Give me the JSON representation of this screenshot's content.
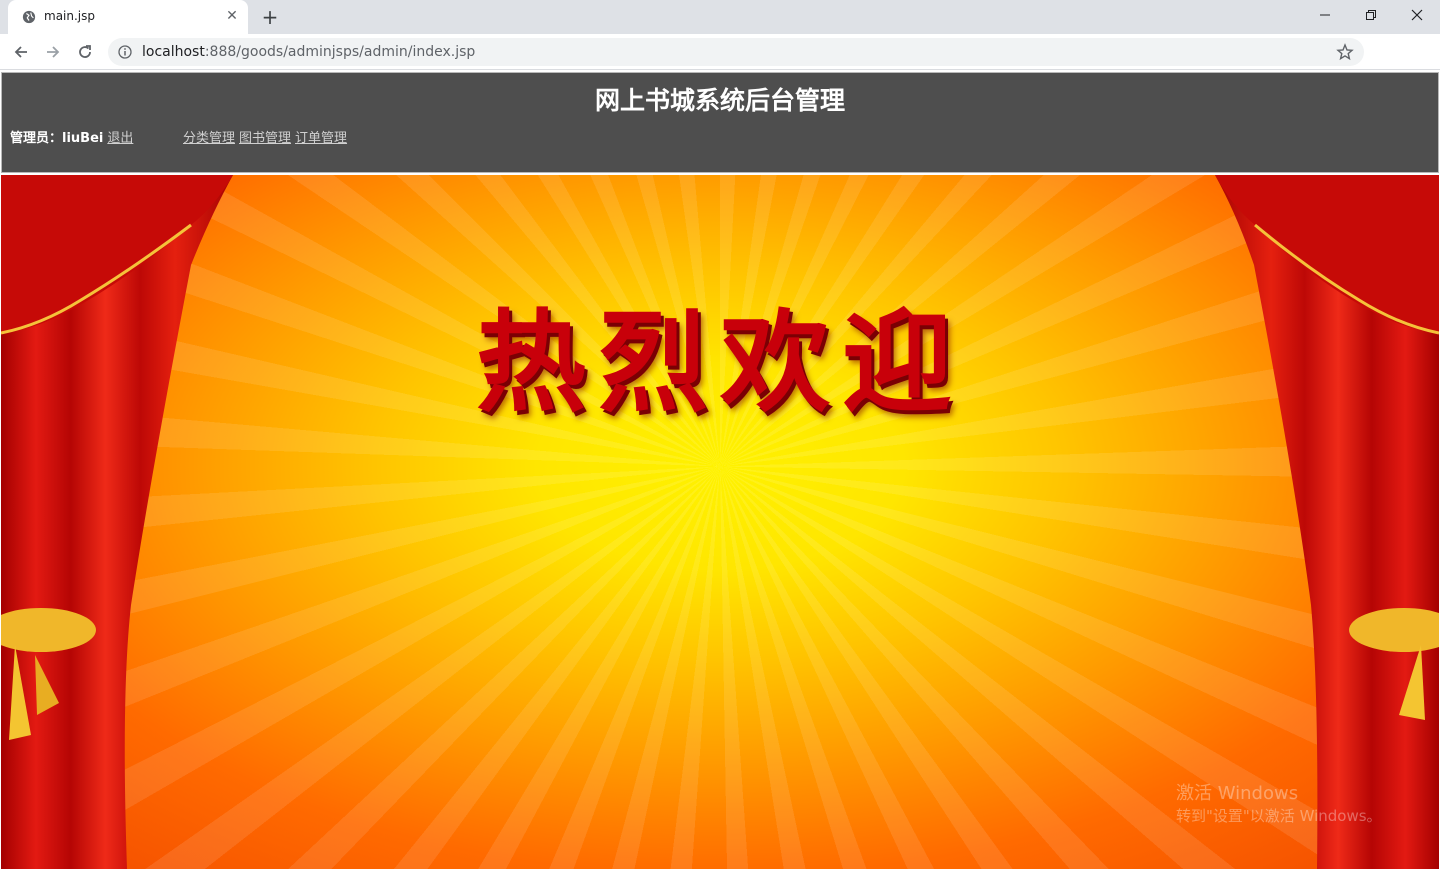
{
  "browser": {
    "tab_title": "main.jsp",
    "new_tab_symbol": "+",
    "url_host": "localhost",
    "url_path": ":888/goods/adminjsps/admin/index.jsp",
    "icons": [
      "globe-icon",
      "close-icon",
      "back-icon",
      "forward-icon",
      "reload-icon",
      "info-icon",
      "star-icon",
      "profile-icon",
      "menu-icon",
      "minimize-icon",
      "restore-icon"
    ]
  },
  "header": {
    "title": "网上书城系统后台管理",
    "admin_label": "管理员：liuBei",
    "logout_label": "退出",
    "menu": [
      {
        "label": "分类管理"
      },
      {
        "label": "图书管理"
      },
      {
        "label": "订单管理"
      }
    ]
  },
  "banner": {
    "welcome_text": "热烈欢迎",
    "colors": {
      "center": "#fff200",
      "edge": "#f24a00",
      "curtain": "#d8110f",
      "text": "#c8000a"
    }
  },
  "watermark": {
    "line1": "激活 Windows",
    "line2": "转到\"设置\"以激活 Windows。"
  }
}
